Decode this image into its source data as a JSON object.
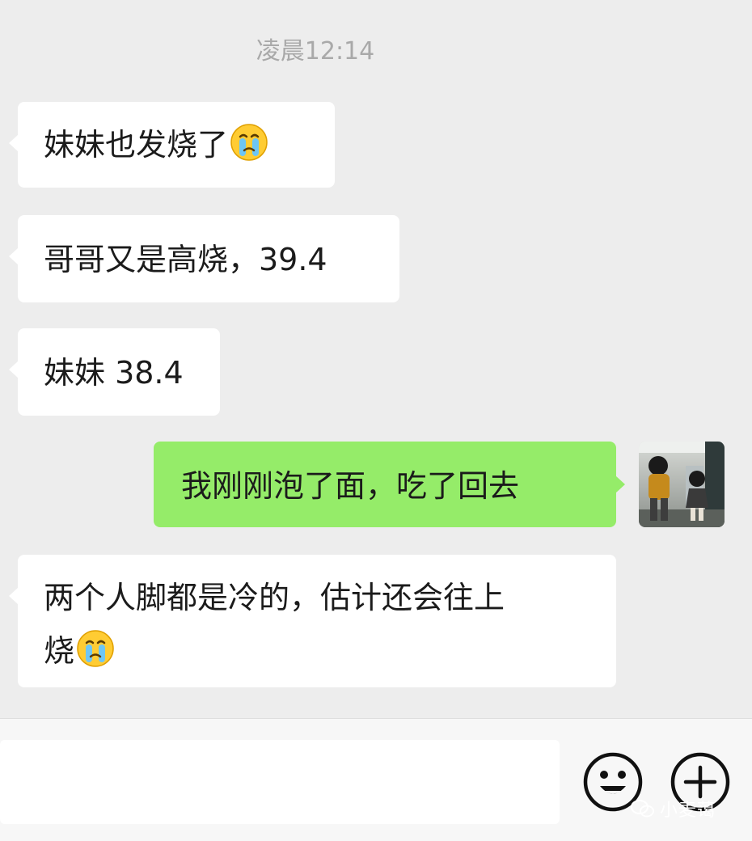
{
  "chat": {
    "timestamp": "凌晨12:14",
    "messages": [
      {
        "side": "incoming",
        "text": "妹妹也发烧了",
        "emoji": "crying-face-emoji"
      },
      {
        "side": "incoming",
        "text": "哥哥又是高烧，39.4"
      },
      {
        "side": "incoming",
        "text": "妹妹 38.4"
      },
      {
        "side": "outgoing",
        "text": "我刚刚泡了面，吃了回去"
      },
      {
        "side": "incoming",
        "text_line1": "两个人脚都是冷的，估计还会往上",
        "text_line2": "烧",
        "emoji": "crying-face-emoji"
      }
    ]
  },
  "input_bar": {
    "icons": [
      "emoji-smile-icon",
      "plus-circle-icon"
    ]
  },
  "watermark": {
    "text": "小麦蔼"
  },
  "colors": {
    "background": "#ededed",
    "incoming_bubble": "#ffffff",
    "outgoing_bubble": "#95ec69",
    "timestamp": "#a9a9a9",
    "text": "#1b1b1b"
  }
}
